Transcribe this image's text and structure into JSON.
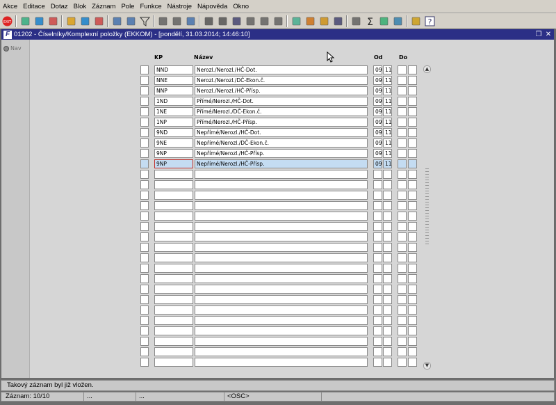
{
  "menu": [
    "Akce",
    "Editace",
    "Dotaz",
    "Blok",
    "Záznam",
    "Pole",
    "Funkce",
    "Nástroje",
    "Nápověda",
    "Okno"
  ],
  "toolbar_icons": [
    "exit-icon",
    "save-icon",
    "print-icon",
    "delete-icon",
    "enter-query-icon",
    "execute-query-icon",
    "cancel-query-icon",
    "sort-asc-icon",
    "sort-desc-icon",
    "filter-icon",
    "printer-icon",
    "copy-icon",
    "mail-icon",
    "cut-icon",
    "paste-icon",
    "find-icon",
    "list-icon",
    "calculator-icon",
    "document-icon",
    "globe-icon",
    "settings-icon",
    "chart-icon",
    "edit-icon",
    "calendar-icon",
    "sum-icon",
    "excel-icon",
    "word-icon",
    "warning-icon",
    "help-icon"
  ],
  "window": {
    "title": "01202 - Číselníky/Komplexní položky (EKKOM) - [pondělí, 31.03.2014; 14:46:10]"
  },
  "nav_label": "Nav",
  "headers": {
    "kp": "KP",
    "nazev": "Název",
    "od": "Od",
    "do": "Do"
  },
  "rows": [
    {
      "kp": "NND",
      "nazev": "Nerozl./Nerozl./HČ-Dot.",
      "od1": "09",
      "od2": "11",
      "do1": "",
      "do2": ""
    },
    {
      "kp": "NNE",
      "nazev": "Nerozl./Nerozl./DČ-Ekon.č.",
      "od1": "09",
      "od2": "11",
      "do1": "",
      "do2": ""
    },
    {
      "kp": "NNP",
      "nazev": "Nerozl./Nerozl./HČ-Přísp.",
      "od1": "09",
      "od2": "11",
      "do1": "",
      "do2": ""
    },
    {
      "kp": "1ND",
      "nazev": "Přímé/Nerozl./HČ-Dot.",
      "od1": "09",
      "od2": "11",
      "do1": "",
      "do2": ""
    },
    {
      "kp": "1NE",
      "nazev": "Přímé/Nerozl./DČ-Ekon.č.",
      "od1": "09",
      "od2": "11",
      "do1": "",
      "do2": ""
    },
    {
      "kp": "1NP",
      "nazev": "Přímé/Nerozl./HČ-Přísp.",
      "od1": "09",
      "od2": "11",
      "do1": "",
      "do2": ""
    },
    {
      "kp": "9ND",
      "nazev": "Nepřímé/Nerozl./HČ-Dot.",
      "od1": "09",
      "od2": "11",
      "do1": "",
      "do2": ""
    },
    {
      "kp": "9NE",
      "nazev": "Nepřímé/Nerozl./DČ-Ekon.č.",
      "od1": "09",
      "od2": "11",
      "do1": "",
      "do2": ""
    },
    {
      "kp": "9NP",
      "nazev": "Nepřímé/Nerozl./HČ-Přísp.",
      "od1": "09",
      "od2": "11",
      "do1": "",
      "do2": ""
    },
    {
      "kp": "9NP",
      "nazev": "Nepřímé/Nerozl./HČ-Přísp.",
      "od1": "09",
      "od2": "11",
      "do1": "",
      "do2": ""
    }
  ],
  "selected_row_index": 9,
  "status": {
    "message": "Takový záznam byl již vložen.",
    "record": "Záznam: 10/10",
    "seg2": "...",
    "seg3": "...",
    "mode": "<OSC>"
  }
}
